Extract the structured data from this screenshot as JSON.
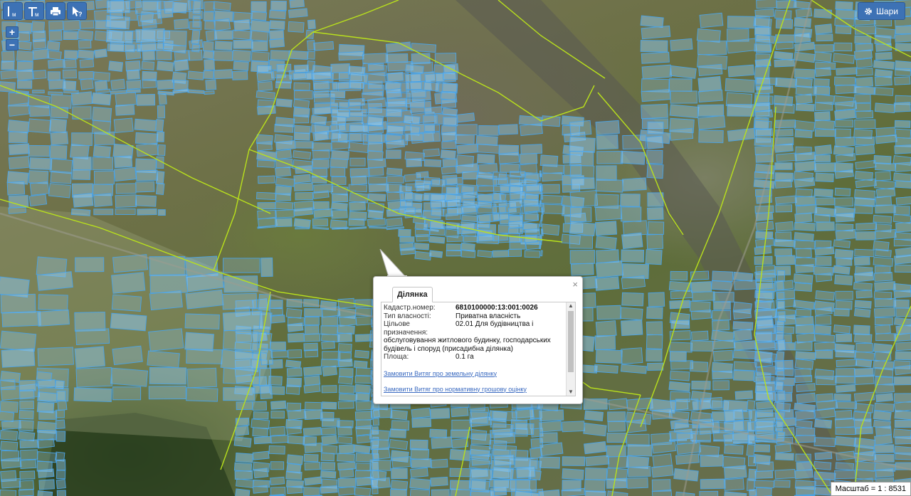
{
  "toolbar": {
    "tools": [
      {
        "name": "measure-line-tool",
        "icon": "ruler-line-icon",
        "sub": "м"
      },
      {
        "name": "measure-area-tool",
        "icon": "ruler-area-icon",
        "sub": "м"
      },
      {
        "name": "print-tool",
        "icon": "printer-icon"
      },
      {
        "name": "identify-tool",
        "icon": "cursor-question-icon"
      }
    ],
    "zoom_in": "+",
    "zoom_out": "−"
  },
  "layers_button": {
    "label": "Шари",
    "icon": "gear-icon"
  },
  "popup": {
    "tab": "Ділянка",
    "close": "×",
    "fields": [
      {
        "label": "Кадастр.номер:",
        "value": "6810100000:13:001:0026"
      },
      {
        "label": "Тип власності:",
        "value": "Приватна власність"
      },
      {
        "label": "Цільове призначення:",
        "value": "02.01 Для будівництва і"
      },
      {
        "label": "",
        "value": "обслуговування житлового будинку, господарських"
      },
      {
        "label": "",
        "value": "будівель і споруд (присадибна ділянка)"
      },
      {
        "label": "Площа:",
        "value": "0.1 га"
      }
    ],
    "link1": "Замовити Витяг про земельну ділянку",
    "link2": "Замовити Витяг про нормативну грошову оцінку"
  },
  "scale": {
    "label": "Масштаб = 1 : 8531"
  },
  "colors": {
    "parcel_fill": "#8ec8ee",
    "parcel_stroke": "#4aa3e6",
    "boundary": "#b9e11c",
    "button": "#3d72b5"
  }
}
